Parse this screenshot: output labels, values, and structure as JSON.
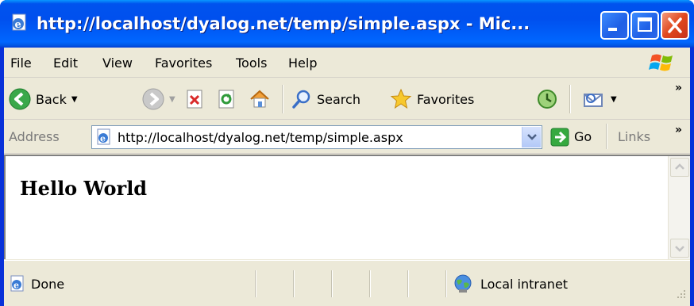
{
  "window": {
    "title": "http://localhost/dyalog.net/temp/simple.aspx - Mic...",
    "controls": [
      "minimize",
      "maximize",
      "close"
    ]
  },
  "menubar": {
    "items": [
      "File",
      "Edit",
      "View",
      "Favorites",
      "Tools",
      "Help"
    ]
  },
  "toolbar": {
    "back_label": "Back",
    "search_label": "Search",
    "favorites_label": "Favorites",
    "overflow": "»"
  },
  "address": {
    "label": "Address",
    "url": "http://localhost/dyalog.net/temp/simple.aspx",
    "go_label": "Go",
    "links_label": "Links",
    "links_more": "»"
  },
  "page": {
    "heading": "Hello World"
  },
  "status": {
    "text": "Done",
    "zone": "Local intranet"
  },
  "colors": {
    "titlebar": "#0058e6",
    "chrome": "#ece9d8",
    "close_button": "#e0481e"
  },
  "icons": {
    "title": "ie-page-icon",
    "back": "back-arrow-icon",
    "forward": "forward-arrow-icon",
    "stop": "stop-icon",
    "refresh": "refresh-icon",
    "home": "home-icon",
    "search": "search-icon",
    "favorites": "favorites-star-icon",
    "history": "history-icon",
    "mail": "mail-icon",
    "go": "go-arrow-icon",
    "zone": "local-intranet-icon"
  }
}
